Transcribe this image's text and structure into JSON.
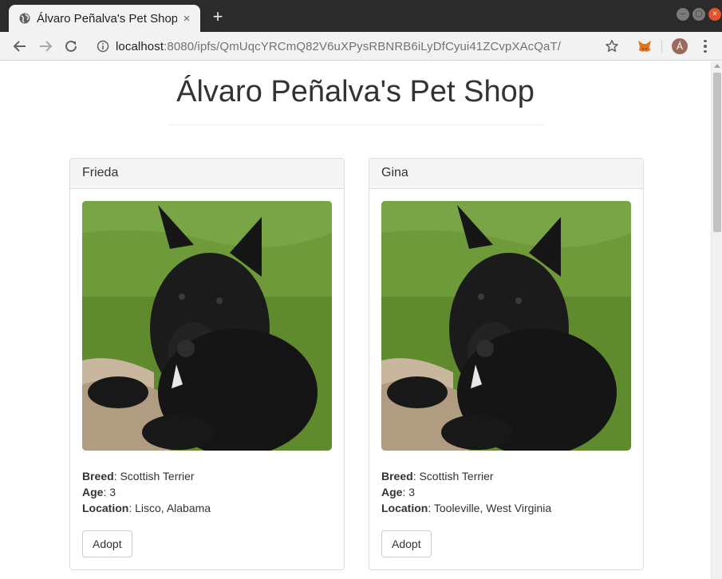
{
  "browser": {
    "tab_title": "Álvaro Peñalva's Pet Shop",
    "tab_close": "×",
    "new_tab": "+",
    "url_host": "localhost",
    "url_rest": ":8080/ipfs/QmUqcYRCmQ82V6uXPysRBNRB6iLyDfCyui41ZCvpXAcQaT/",
    "avatar_letter": "Á",
    "window_buttons": {
      "minimize": "–",
      "maximize": "▢",
      "close": "×"
    }
  },
  "page": {
    "title": "Álvaro Peñalva's Pet Shop"
  },
  "labels": {
    "breed": "Breed",
    "age": "Age",
    "location": "Location",
    "separator": ": "
  },
  "pets": [
    {
      "name": "Frieda",
      "breed": "Scottish Terrier",
      "age": "3",
      "location": "Lisco, Alabama",
      "button": "Adopt"
    },
    {
      "name": "Gina",
      "breed": "Scottish Terrier",
      "age": "3",
      "location": "Tooleville, West Virginia",
      "button": "Adopt"
    }
  ],
  "colors": {
    "titlebar": "#2b2b2b",
    "toolbar": "#f2f2f2",
    "panel_heading": "#f5f5f5",
    "text": "#333333"
  }
}
